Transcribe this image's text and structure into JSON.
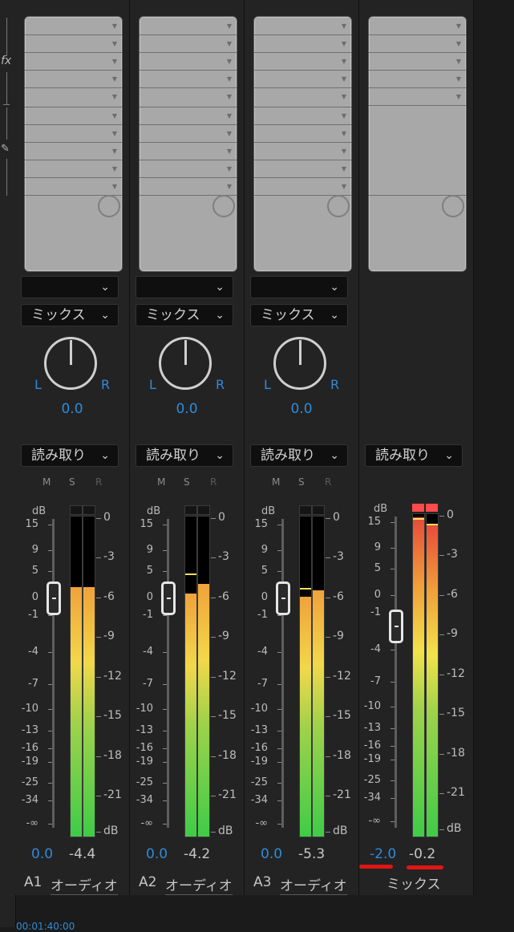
{
  "colors": {
    "accent": "#2f8bd9",
    "background": "#232323",
    "meter_top": "#f0a23a",
    "meter_bottom": "#3fcc48",
    "clip": "#ff4a4a",
    "annotation": "#e01515"
  },
  "rail": {
    "fx_label": "fx",
    "icons": [
      "fx-icon",
      "pen-icon"
    ]
  },
  "fader_scale": [
    "15",
    "9",
    "5",
    "0",
    "-1",
    "-4",
    "-7",
    "-10",
    "-13",
    "-16",
    "-19",
    "-25",
    "-34",
    "-∞"
  ],
  "meter_scale": [
    "0",
    "-3",
    "-6",
    "-9",
    "-12",
    "-15",
    "-18",
    "-21",
    "dB"
  ],
  "db_label": "dB",
  "msr": {
    "m": "M",
    "s": "S",
    "r": "R"
  },
  "channels": [
    {
      "id": "A1",
      "name": "オーディオ",
      "send": "",
      "mix": "ミックス",
      "pan": "0.0",
      "L": "L",
      "R": "R",
      "automation": "読み取り",
      "volume": "0.0",
      "peak": "-4.4",
      "level_left": 0.78,
      "level_right": 0.78
    },
    {
      "id": "A2",
      "name": "オーディオ",
      "send": "",
      "mix": "ミックス",
      "pan": "0.0",
      "L": "L",
      "R": "R",
      "automation": "読み取り",
      "volume": "0.0",
      "peak": "-4.2",
      "level_left": 0.76,
      "level_right": 0.79
    },
    {
      "id": "A3",
      "name": "オーディオ",
      "send": "",
      "mix": "ミックス",
      "pan": "0.0",
      "L": "L",
      "R": "R",
      "automation": "読み取り",
      "volume": "0.0",
      "peak": "-5.3",
      "level_left": 0.74,
      "level_right": 0.75
    }
  ],
  "master": {
    "name": "ミックス",
    "automation": "読み取り",
    "volume": "-2.0",
    "peak": "-0.2",
    "level_left": 0.99,
    "level_right": 0.97
  },
  "timecode": "00:01:40:00"
}
